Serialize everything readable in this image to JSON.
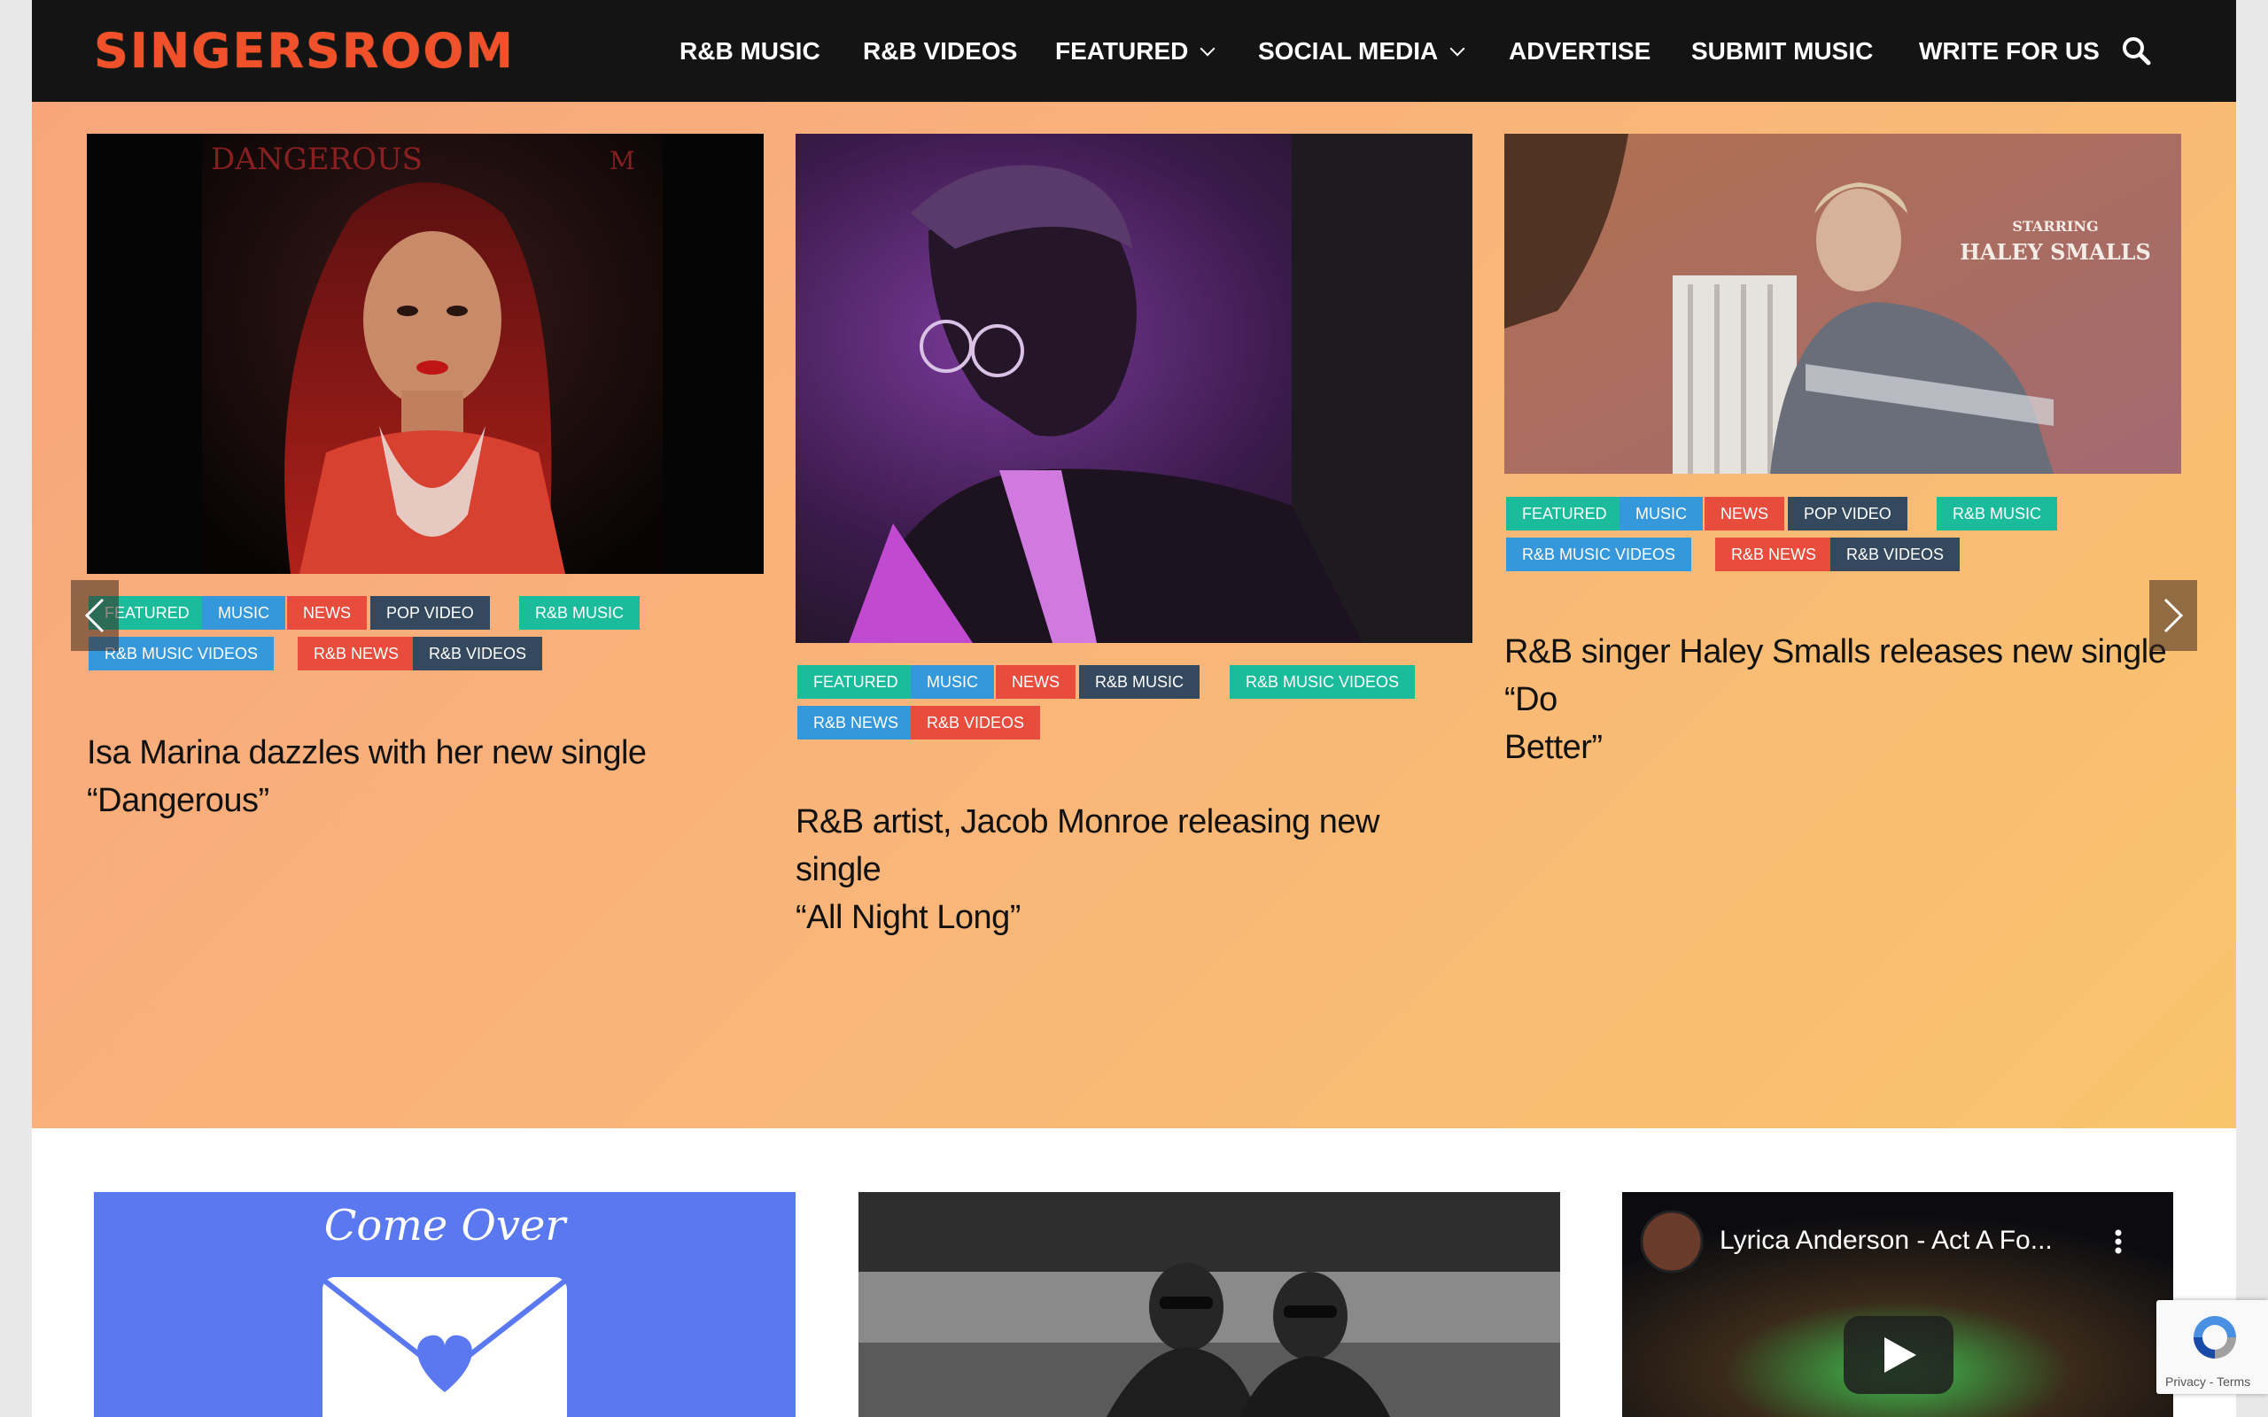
{
  "brand": {
    "logo_text": "SINGERSROOM",
    "accent": "#f0512b"
  },
  "nav": {
    "items": [
      {
        "label": "R&B MUSIC"
      },
      {
        "label": "R&B VIDEOS"
      },
      {
        "label": "FEATURED"
      },
      {
        "label": "SOCIAL MEDIA"
      },
      {
        "label": "ADVERTISE"
      },
      {
        "label": "SUBMIT MUSIC"
      },
      {
        "label": "WRITE FOR US"
      }
    ],
    "search_icon": "search-icon"
  },
  "slider": {
    "cards": [
      {
        "tags": [
          "FEATURED",
          "MUSIC",
          "NEWS",
          "POP VIDEO",
          "R&B MUSIC",
          "R&B MUSIC VIDEOS",
          "R&B NEWS",
          "R&B VIDEOS"
        ],
        "title_line1": "Isa Marina dazzles with her new single",
        "title_line2": "“Dangerous”",
        "image_text_top": "DANGEROUS"
      },
      {
        "tags": [
          "FEATURED",
          "MUSIC",
          "NEWS",
          "R&B MUSIC",
          "R&B MUSIC VIDEOS",
          "R&B NEWS",
          "R&B VIDEOS"
        ],
        "title_line1": "R&B artist, Jacob Monroe releasing new single",
        "title_line2": "“All Night Long”"
      },
      {
        "tags": [
          "FEATURED",
          "MUSIC",
          "NEWS",
          "POP VIDEO",
          "R&B MUSIC",
          "R&B MUSIC VIDEOS",
          "R&B NEWS",
          "R&B VIDEOS"
        ],
        "title_line1": "R&B singer Haley Smalls releases new single “Do",
        "title_line2": "Better”",
        "image_text_small": "STARRING",
        "image_text_large": "HALEY SMALLS"
      }
    ],
    "prev_icon": "chevron-left-icon",
    "next_icon": "chevron-right-icon"
  },
  "bottom": {
    "promo_text": "Come Over",
    "video_title": "Lyrica Anderson - Act A Fo...",
    "recaptcha_text": "Privacy - Terms"
  },
  "tag_colors": {
    "green": "#1abc9c",
    "blue": "#3498db",
    "red": "#e74c3c",
    "dark": "#34495e"
  }
}
